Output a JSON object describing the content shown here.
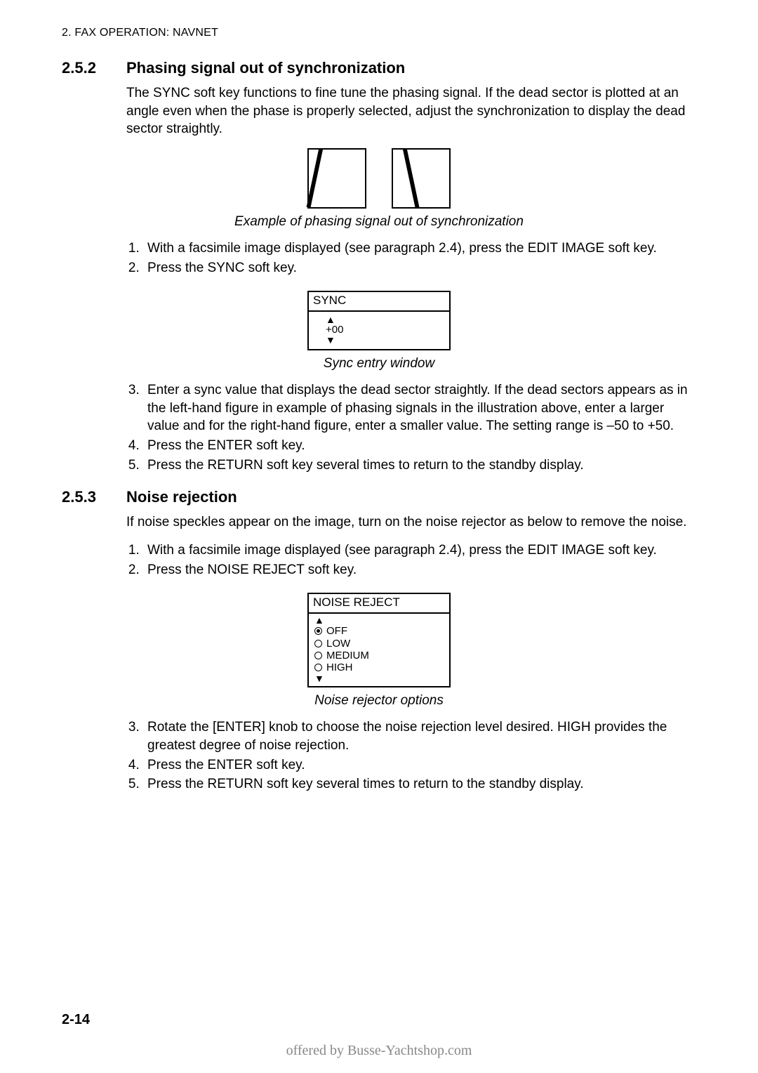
{
  "header": "2. FAX OPERATION: NAVNET",
  "section1": {
    "num": "2.5.2",
    "title": "Phasing signal out of synchronization",
    "intro": "The SYNC soft key functions to fine tune the phasing signal. If the dead sector is plotted at an angle even when the phase is properly selected, adjust the synchronization to display the dead sector straightly.",
    "fig_caption": "Example of phasing signal out of synchronization",
    "steps_a": [
      "With a facsimile image displayed (see paragraph 2.4), press the EDIT IMAGE soft key.",
      "Press the SYNC soft key."
    ],
    "sync_window": {
      "title": "SYNC",
      "value": "+00"
    },
    "sync_caption": "Sync entry window",
    "steps_b": [
      "Enter a sync value that displays the dead sector straightly. If the dead sectors appears as in the left-hand figure in example of phasing signals in the illustration above, enter a larger value and for the right-hand figure, enter a smaller value. The setting range is –50 to +50.",
      "Press the ENTER soft key.",
      "Press the RETURN soft key several times to return to the standby display."
    ]
  },
  "section2": {
    "num": "2.5.3",
    "title": "Noise rejection",
    "intro": "If noise speckles appear on the image, turn on the noise rejector as below to remove the noise.",
    "steps_a": [
      "With a facsimile image displayed (see paragraph 2.4), press the EDIT IMAGE soft key.",
      "Press the NOISE REJECT soft key."
    ],
    "nr_window": {
      "title": "NOISE REJECT",
      "options": [
        "OFF",
        "LOW",
        "MEDIUM",
        "HIGH"
      ],
      "selected": "OFF"
    },
    "nr_caption": "Noise rejector options",
    "steps_b": [
      "Rotate the [ENTER] knob to choose the noise rejection level desired. HIGH provides the greatest degree of noise rejection.",
      "Press the ENTER soft key.",
      "Press the RETURN soft key several times to return to the standby display."
    ]
  },
  "page_number": "2-14",
  "footer": "offered by Busse-Yachtshop.com"
}
